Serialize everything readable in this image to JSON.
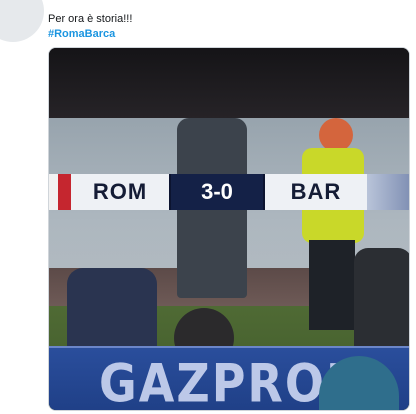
{
  "tweet": {
    "text": "Per ora è storia!!!",
    "hashtag": "#RomaBarca"
  },
  "media": {
    "scoreboard": {
      "home_team": "ROM",
      "score": "3-0",
      "away_team": "BAR"
    },
    "ad_board_text": "GAZPROM"
  },
  "colors": {
    "hashtag": "#1b95e0",
    "score_box": "#142147",
    "ad_board": "#2a4e9c"
  }
}
